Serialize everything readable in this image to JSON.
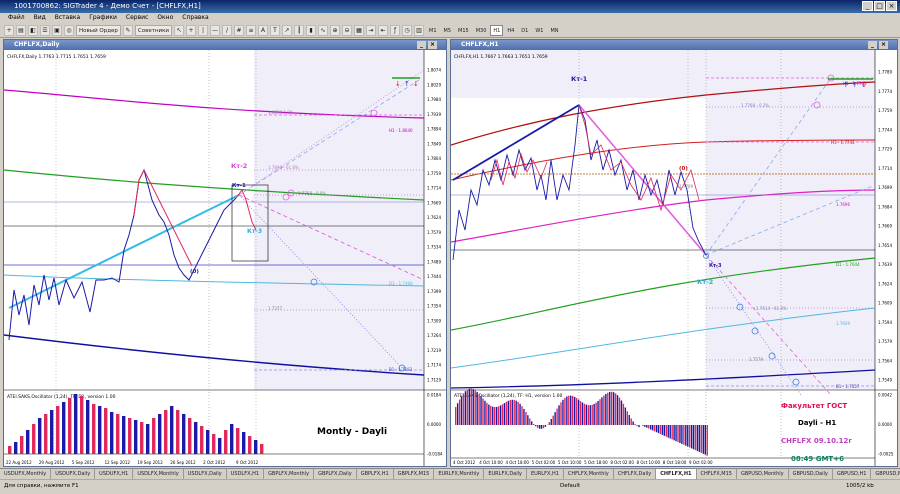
{
  "app": {
    "title": "1001700862: SIGTrader 4 - Демо Счет - [CHFLFX,H1]"
  },
  "menu": [
    "Файл",
    "Вид",
    "Вставка",
    "Графики",
    "Сервис",
    "Окно",
    "Справка"
  ],
  "toolbar": {
    "new_order": "Новый Ордер",
    "advisors": "Советники",
    "periods": [
      "M1",
      "M5",
      "M15",
      "M30",
      "H1",
      "H4",
      "D1",
      "W1",
      "MN"
    ]
  },
  "left_window": {
    "title": "CHFLFX,Daily",
    "info": "CHFLFX,Daily 1.7763 1.7715 1.7651 1.7659",
    "indicator": "ATEI.SAKS.Oscillator (1,24), TF: D1, version 1.00",
    "label_main": "Montly - Dayli",
    "labels": {
      "kt2": "Кт-2",
      "kt1": "Кт-1",
      "kt3": "Кт-3",
      "zero": "(0)"
    },
    "price_ticks": [
      "1.8074",
      "1.8029",
      "1.7984",
      "1.7939",
      "1.7894",
      "1.7849",
      "1.7804",
      "1.7759",
      "1.7714",
      "1.7669",
      "1.7624",
      "1.7579",
      "1.7534",
      "1.7489",
      "1.7444",
      "1.7399",
      "1.7354",
      "1.7309",
      "1.7264",
      "1.7219",
      "1.7174",
      "1.7129"
    ],
    "date_ticks": [
      "22 Aug 2012",
      "29 Aug 2012",
      "5 Sep 2012",
      "12 Sep 2012",
      "19 Sep 2012",
      "26 Sep 2012",
      "2 Oct 2012",
      "9 Oct 2012"
    ],
    "level_labels": {
      "h1": "H1 - 1.8040",
      "d1": "D1 - 1.7468",
      "b1": "B1 - 1.7182",
      "l1": "1.8038.3.8%",
      "l2": "1.7898 - 61.8%",
      "l3": "1.7758 - 0.0%",
      "l4": "1.7377"
    },
    "osc_ticks": [
      "0.0184",
      "0.0000",
      "-0.0184"
    ]
  },
  "right_window": {
    "title": "CHFLFX,H1",
    "info": "CHFLFX,H1 1.7667 1.7663 1.7651 1.7659",
    "indicator": "ATEI.SAKS.Oscillator (1,24), TF: H1, version 1.00",
    "labels": {
      "kt1": "Кт-1",
      "kt2": "Кт-2",
      "kt3": "Кт-3",
      "zero": "(0)"
    },
    "price_ticks": [
      "1.7789",
      "1.7774",
      "1.7759",
      "1.7744",
      "1.7729",
      "1.7714",
      "1.7699",
      "1.7684",
      "1.7669",
      "1.7654",
      "1.7639",
      "1.7624",
      "1.7609",
      "1.7594",
      "1.7579",
      "1.7564",
      "1.7549"
    ],
    "date_ticks": [
      "4 Oct 2012",
      "4 Oct 10:00",
      "4 Oct 18:00",
      "5 Oct 02:00",
      "5 Oct 10:00",
      "5 Oct 18:00",
      "8 Oct 02:00",
      "8 Oct 10:00",
      "8 Oct 18:00",
      "9 Oct 02:00"
    ],
    "level_labels": {
      "h1": "H1 - 1.7763",
      "l1": "1.7768 - 0.2%",
      "h1b": "H1 - 1.7743",
      "b1": "1.7709",
      "l3": "1.7696",
      "d1": "D1 - 1.7644",
      "l5": "1.7614 - 61.8%",
      "l6": "1.7609",
      "l7": "1.7579",
      "b1b": "B1 - 1.7557"
    },
    "osc_ticks": [
      "0.0042",
      "0.0000",
      "-0.0025"
    ],
    "overlay": {
      "line1": "Факультет ГОСТ",
      "line2": "Dayli - H1",
      "line3": "CHFLFX 09.10.12г",
      "line4": "08:49 GMT+6"
    }
  },
  "tabs": [
    "USDUFX,Monthly",
    "USDUFX,Daily",
    "USDUFX,H1",
    "USDLFX,Monthly",
    "USDLFX,Daily",
    "USDLFX,H1",
    "GBPLFX,Monthly",
    "GBPLFX,Daily",
    "GBPLFX,H1",
    "GBPLFX,M15",
    "EURLFX,Monthly",
    "EURLFX,Daily",
    "EURLFX,H1",
    "CHFLFX,Monthly",
    "CHFLFX,Daily",
    "CHFLFX,H1",
    "CHFLFX,M15",
    "GBPUSD,Monthly",
    "GBPUSD,Daily",
    "GBPUSD,H1",
    "GBPUSD,M15",
    "EURUSD,Monthly",
    "EURUSD,Daily",
    "EURUSD,H1"
  ],
  "active_tab": "CHFLFX,H1",
  "status": {
    "help": "Для справки, нажмите F1",
    "profile": "Default",
    "traffic": "1005/2 kb"
  },
  "colors": {
    "up": "#1a1aa8",
    "down": "#e0285a",
    "fib": "#e060e0",
    "trend": "#33bbe8"
  }
}
